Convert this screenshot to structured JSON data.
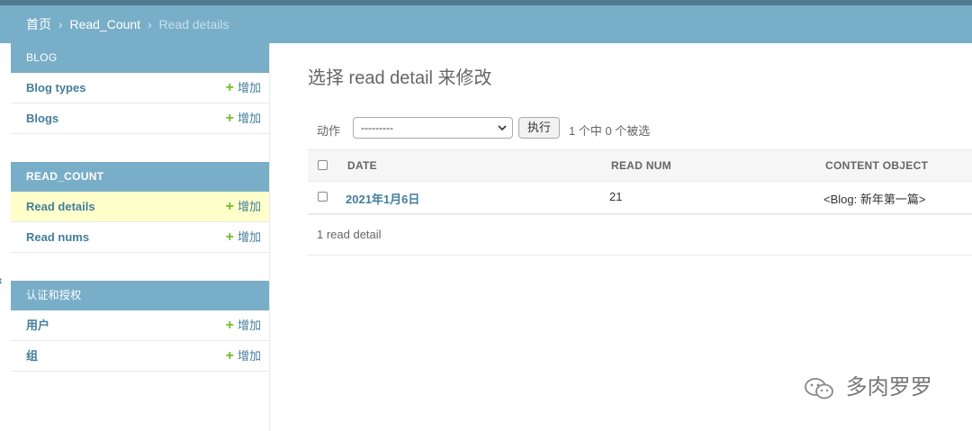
{
  "breadcrumbs": {
    "home": "首页",
    "app": "Read_Count",
    "current": "Read details",
    "separator": "›"
  },
  "sidebar": {
    "modules": [
      {
        "header": "BLOG",
        "models": [
          {
            "name": "Blog types",
            "add": "增加"
          },
          {
            "name": "Blogs",
            "add": "增加"
          }
        ]
      },
      {
        "header": "READ_COUNT",
        "models": [
          {
            "name": "Read details",
            "add": "增加"
          },
          {
            "name": "Read nums",
            "add": "增加"
          }
        ]
      },
      {
        "header": "认证和授权",
        "models": [
          {
            "name": "用户",
            "add": "增加"
          },
          {
            "name": "组",
            "add": "增加"
          }
        ]
      }
    ],
    "collapse_glyph": "‹"
  },
  "content": {
    "title": "选择 read detail 来修改",
    "actions": {
      "label": "动作",
      "selected_option": "---------",
      "go_label": "执行",
      "counter": "1 个中 0 个被选"
    },
    "table": {
      "headers": [
        "DATE",
        "READ NUM",
        "CONTENT OBJECT"
      ],
      "rows": [
        {
          "date": "2021年1月6日",
          "read_num": "21",
          "content_object": "<Blog: 新年第一篇>"
        }
      ]
    },
    "paginator": "1 read detail"
  },
  "watermark": {
    "text": "多肉罗罗",
    "icon": "wechat-icon"
  },
  "colors": {
    "header_bg": "#79aec8",
    "top_strip": "#4d7a8f",
    "link": "#447e9b",
    "add_plus": "#70bf2b",
    "selected_row": "#ffffcc"
  }
}
